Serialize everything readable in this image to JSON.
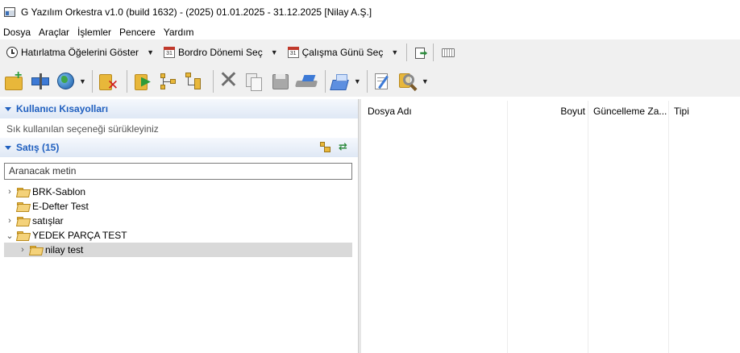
{
  "window": {
    "title": "G Yazılım Orkestra v1.0 (build 1632) - (2025) 01.01.2025 - 31.12.2025 [Nilay A.Ş.]"
  },
  "menu": [
    "Dosya",
    "Araçlar",
    "İşlemler",
    "Pencere",
    "Yardım"
  ],
  "toolbar1": {
    "reminders_label": "Hatırlatma Öğelerini Göster",
    "payroll_period_label": "Bordro Dönemi Seç",
    "workday_label": "Çalışma Günü Seç",
    "calendar_day": "31"
  },
  "shortcuts_panel": {
    "title": "Kullanıcı Kısayolları",
    "hint": "Sık kullanılan seçeneği sürükleyiniz"
  },
  "sales_panel": {
    "title": "Satış (15)",
    "search_placeholder": "Aranacak metin",
    "tree": [
      {
        "label": "BRK-Sablon",
        "chevron": "›"
      },
      {
        "label": "E-Defter Test",
        "chevron": ""
      },
      {
        "label": "satışlar",
        "chevron": "›"
      },
      {
        "label": "YEDEK PARÇA TEST",
        "chevron": "⌄"
      },
      {
        "label": "nilay test",
        "chevron": "›"
      }
    ]
  },
  "file_table": {
    "columns": [
      "Dosya Adı",
      "Boyut",
      "Güncelleme Za...",
      "Tipi"
    ]
  }
}
